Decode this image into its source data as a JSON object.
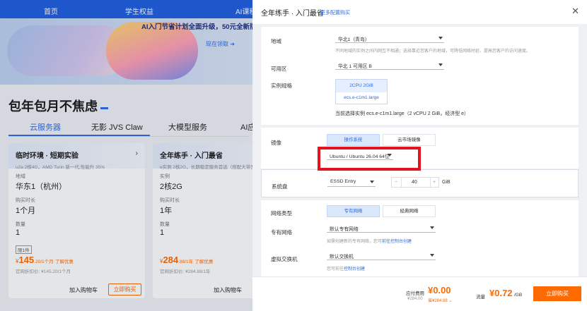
{
  "nav": {
    "items": [
      "首页",
      "学生权益",
      "AI课程"
    ]
  },
  "banner": {
    "promo": "AI入门节省计划全面升级，50元全新版涵盖",
    "link": "现在领取"
  },
  "section": {
    "title": "包年包月不焦虑",
    "categories": [
      "云服务器",
      "无影 JVS Claw",
      "大模型服务",
      "AI应"
    ]
  },
  "cards": [
    {
      "title": "临时环境 · 短期实验",
      "subtitle": "u2a 2核4G，AMD Turin 新一代,性能升 35%",
      "region_label": "地域",
      "region": "华东1（杭州）",
      "duration_label": "购买时长",
      "duration": "1个月",
      "qty_label": "数量",
      "qty": "1",
      "gift": "限1件",
      "currency": "¥",
      "price": "145",
      "price_unit": ".20/1个月",
      "discount": "了解优惠",
      "original": "官网折扣价: ¥145.20/1个月",
      "cart": "加入购物车",
      "buy": "立即购买"
    },
    {
      "title": "全年练手 · 入门最省",
      "subtitle": "e实例 2核2G，长期稳定服务首选（搭配大带宽）",
      "region_label": "实例",
      "region": "2核2G",
      "duration_label": "购买时长",
      "duration": "1年",
      "qty_label": "数量",
      "qty": "1",
      "currency": "¥",
      "price": "284",
      "price_unit": ".88/1年",
      "discount": "了解优惠",
      "original": "官网折扣价: ¥284.88/1年",
      "cart": "加入购物车",
      "buy": "立即"
    }
  ],
  "drawer": {
    "title": "全年练手 · 入门最省",
    "more": "更多配置购买",
    "region": {
      "label": "地域",
      "value": "华北1（青岛）",
      "hint": "不同地域的实例之间内网互不相通；选择靠近您客户的地域，可降低网络时延、提高您客户的访问速度。"
    },
    "zone": {
      "label": "可用区",
      "value": "华北 1 可用区 B"
    },
    "spec": {
      "label": "实例规格",
      "card_top": "2CPU 2GiB",
      "card_bottom": "ecs.e-c1m1.large",
      "current": "当前选择实例 ecs.e-c1m1.large（2 vCPU 2 GiB，经济型 e）"
    },
    "image": {
      "label": "镜像",
      "tabs": [
        "操作系统",
        "云市场镜像"
      ],
      "value": "Ubuntu / Ubuntu 26.04 64位"
    },
    "disk": {
      "label": "系统盘",
      "type": "ESSD Entry",
      "minus": "−",
      "size": "40",
      "plus": "+",
      "unit": "GiB"
    },
    "net_type": {
      "label": "网络类型",
      "options": [
        "专有网络",
        "经典网络"
      ]
    },
    "vpc": {
      "label": "专有网络",
      "value": "默认专有网络",
      "hint_pre": "如需创建新的专有网络，您可",
      "hint_link": "前往控制台创建"
    },
    "vswitch": {
      "label": "虚拟交换机",
      "value": "默认交换机",
      "hint_pre": "您可前往",
      "hint_link": "控制台创建"
    },
    "footer": {
      "fee_label": "应付费用",
      "fee": "¥0.00",
      "fee_orig": "¥284.00",
      "fee_save": "省¥284.88",
      "traffic_label": "流量",
      "traffic": "¥0.72",
      "traffic_unit": "/GB",
      "buy": "立即购买"
    }
  }
}
